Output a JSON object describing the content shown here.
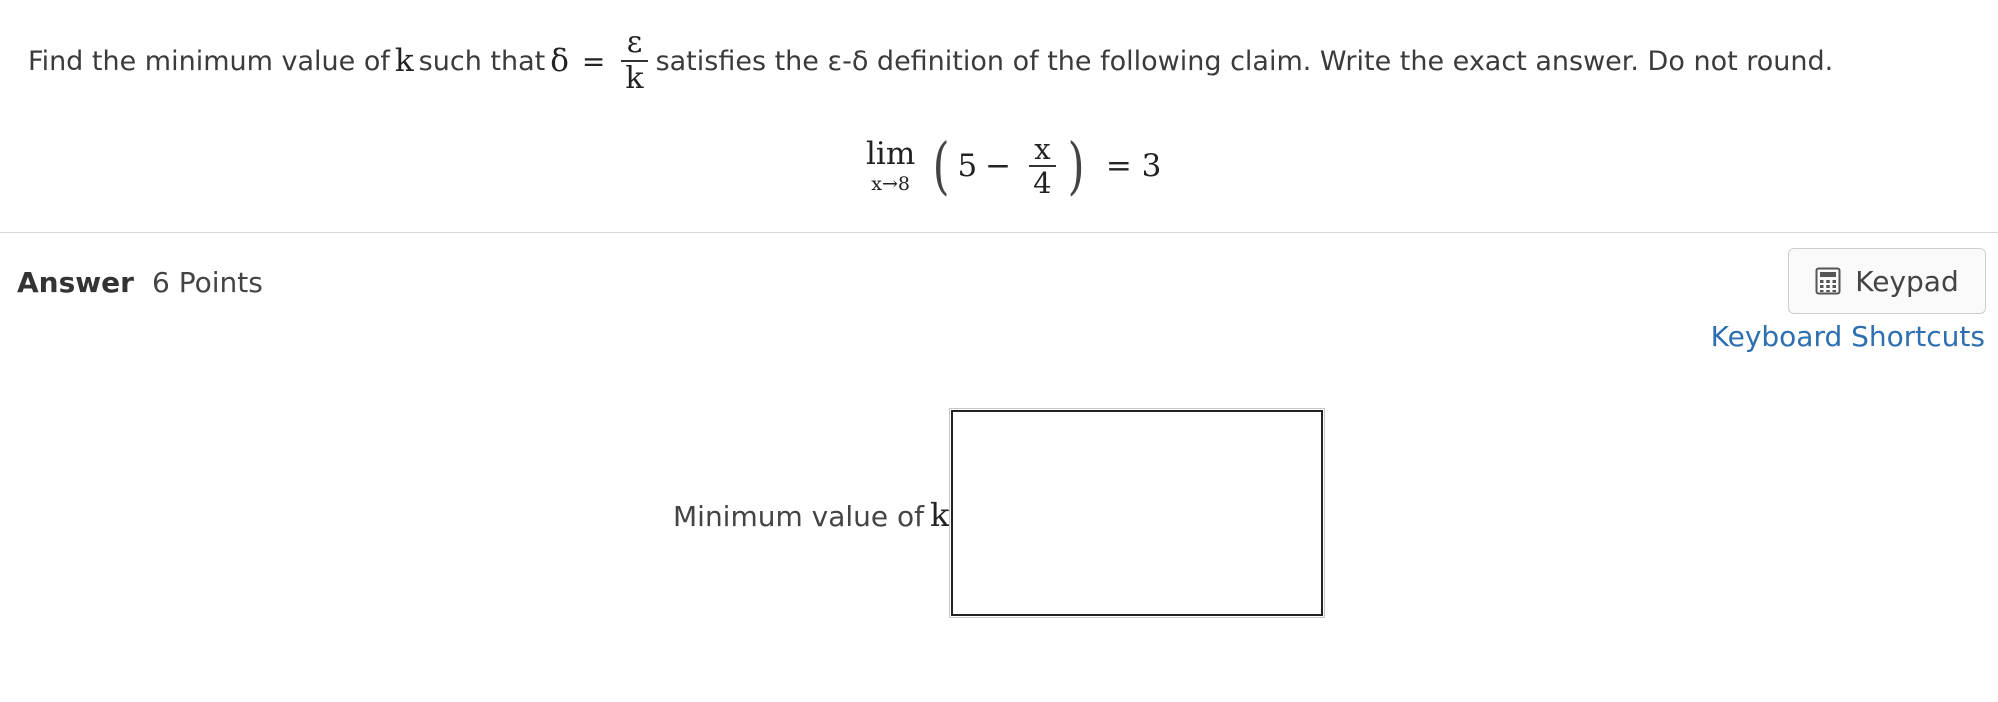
{
  "question": {
    "prefix": "Find the minimum value of",
    "var_k": "k",
    "such_that": "such that",
    "delta": "δ",
    "equals": "=",
    "frac_num": "ε",
    "frac_den": "k",
    "suffix": "satisfies the ε-δ definition of the following claim. Write the exact answer. Do not round."
  },
  "claim": {
    "lim": "lim",
    "lim_sub": "x→8",
    "open_paren": "(",
    "five": "5",
    "minus": "−",
    "frac_num": "x",
    "frac_den": "4",
    "close_paren": ")",
    "rhs": "= 3"
  },
  "answer": {
    "label": "Answer",
    "points": "6 Points",
    "keypad_label": "Keypad",
    "keyboard_shortcuts": "Keyboard Shortcuts",
    "field_label": "Minimum value of",
    "field_var": "k",
    "field_colon": ":",
    "field_value": ""
  }
}
